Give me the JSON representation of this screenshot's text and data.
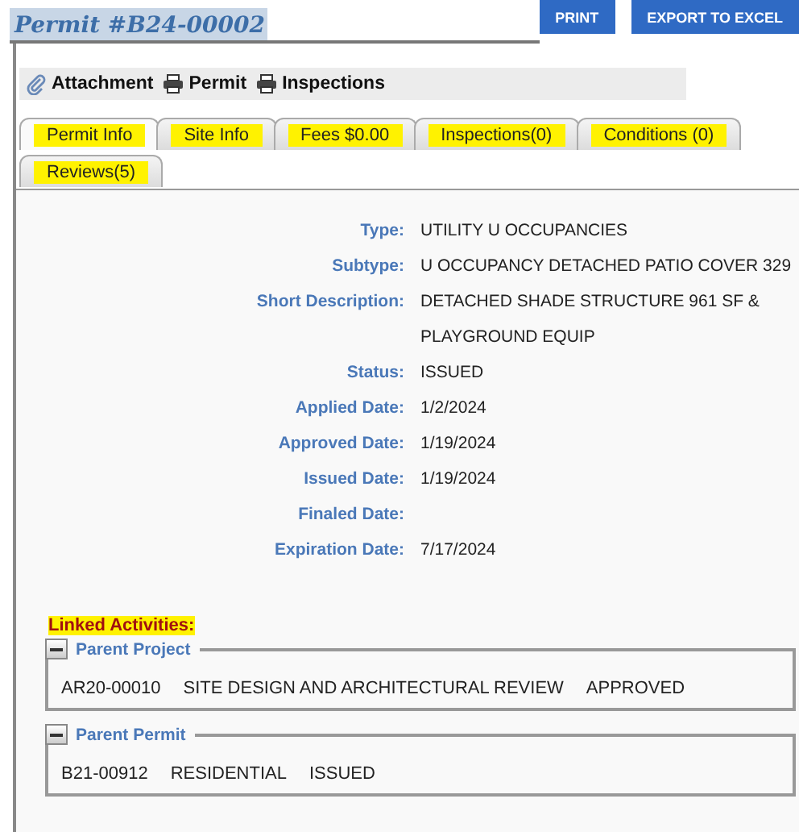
{
  "header": {
    "title": "Permit #B24-00002",
    "buttons": [
      "PRINT",
      "EXPORT TO EXCEL"
    ]
  },
  "toolbar": [
    {
      "label": "Attachment",
      "kind": "attach"
    },
    {
      "label": "Permit",
      "kind": "print"
    },
    {
      "label": "Inspections",
      "kind": "print"
    }
  ],
  "tabs": [
    [
      {
        "label": "Permit Info",
        "selected": true,
        "highlighted": true
      },
      {
        "label": "Site Info",
        "selected": false,
        "highlighted": true
      },
      {
        "label": "Fees $0.00",
        "selected": false,
        "highlighted": true
      },
      {
        "label": "Inspections(0)",
        "selected": false,
        "highlighted": true
      },
      {
        "label": "Conditions (0)",
        "selected": false,
        "highlighted": true
      }
    ],
    [
      {
        "label": "Reviews(5)",
        "selected": false,
        "highlighted": true
      }
    ]
  ],
  "details": [
    {
      "label": "Type:",
      "value": "UTILITY U OCCUPANCIES"
    },
    {
      "label": "Subtype:",
      "value": "U OCCUPANCY DETACHED PATIO COVER 329"
    },
    {
      "label": "Short Description:",
      "value": "DETACHED SHADE STRUCTURE 961 SF & PLAYGROUND EQUIP"
    },
    {
      "label": "Status:",
      "value": "ISSUED"
    },
    {
      "label": "Applied Date:",
      "value": "1/2/2024"
    },
    {
      "label": "Approved Date:",
      "value": "1/19/2024"
    },
    {
      "label": "Issued Date:",
      "value": "1/19/2024"
    },
    {
      "label": "Finaled Date:"
    },
    {
      "label": "Expiration Date:",
      "value": "7/17/2024"
    }
  ],
  "linked_activities": {
    "heading": "Linked Activities:",
    "highlighted": true,
    "groups": [
      {
        "title": "Parent Project",
        "expanded": true,
        "fields": [
          "AR20-00010",
          "SITE DESIGN AND ARCHITECTURAL REVIEW",
          "APPROVED"
        ]
      },
      {
        "title": "Parent Permit",
        "expanded": true,
        "fields": [
          "B21-00912",
          "RESIDENTIAL",
          "ISSUED"
        ]
      }
    ]
  }
}
